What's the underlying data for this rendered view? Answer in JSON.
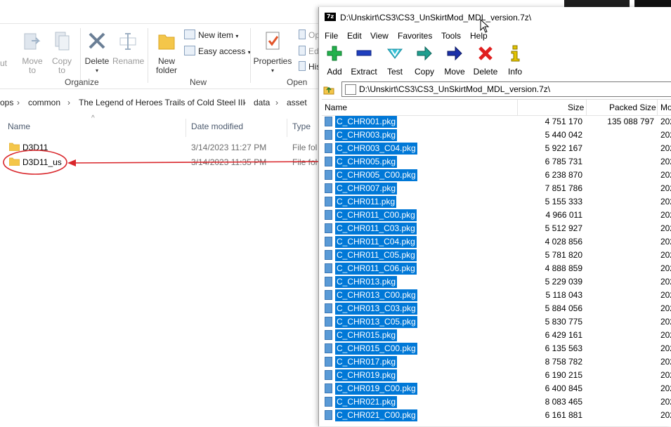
{
  "explorer": {
    "ribbon": {
      "move_to": "Move\nto",
      "copy_to": "Copy\nto",
      "delete": "Delete",
      "rename": "Rename",
      "new_folder": "New\nfolder",
      "new_item": "New item",
      "easy_access": "Easy access",
      "properties": "Properties",
      "open_partial": "Op",
      "edit_partial": "Ed",
      "history_partial": "His",
      "left_partial": "ut",
      "groups": {
        "organize": "Organize",
        "new": "New",
        "open": "Open"
      }
    },
    "breadcrumb": [
      "ops",
      "common",
      "The Legend of Heroes Trails of Cold Steel III",
      "data",
      "asset"
    ],
    "columns": {
      "name": "Name",
      "date": "Date modified",
      "type": "Type"
    },
    "files": [
      {
        "name": "D3D11",
        "date": "3/14/2023 11:27 PM",
        "type": "File fol"
      },
      {
        "name": "D3D11_us",
        "date": "3/14/2023 11:35 PM",
        "type": "File fol"
      }
    ]
  },
  "sevenzip": {
    "app_icon": "7z",
    "title": "D:\\Unskirt\\CS3\\CS3_UnSkirtMod_MDL_version.7z\\",
    "menu": [
      "File",
      "Edit",
      "View",
      "Favorites",
      "Tools",
      "Help"
    ],
    "toolbar": [
      {
        "label": "Add",
        "icon": "plus-icon",
        "color": "#22b14c"
      },
      {
        "label": "Extract",
        "icon": "minus-icon",
        "color": "#1f3fbf"
      },
      {
        "label": "Test",
        "icon": "check-icon",
        "color": "#36c3d8"
      },
      {
        "label": "Copy",
        "icon": "copy-arrow-icon",
        "color": "#1f9e8f"
      },
      {
        "label": "Move",
        "icon": "move-arrow-icon",
        "color": "#1a2fa8"
      },
      {
        "label": "Delete",
        "icon": "x-icon",
        "color": "#e02020"
      },
      {
        "label": "Info",
        "icon": "info-icon",
        "color": "#e3c400"
      }
    ],
    "path": "D:\\Unskirt\\CS3\\CS3_UnSkirtMod_MDL_version.7z\\",
    "columns": {
      "name": "Name",
      "size": "Size",
      "packed": "Packed Size",
      "modified": "Mo"
    },
    "files": [
      {
        "name": "C_CHR001.pkg",
        "size": "4 751 170",
        "packed": "135 088 797",
        "mod": "202"
      },
      {
        "name": "C_CHR003.pkg",
        "size": "5 440 042",
        "packed": "",
        "mod": "202"
      },
      {
        "name": "C_CHR003_C04.pkg",
        "size": "5 922 167",
        "packed": "",
        "mod": "202"
      },
      {
        "name": "C_CHR005.pkg",
        "size": "6 785 731",
        "packed": "",
        "mod": "202"
      },
      {
        "name": "C_CHR005_C00.pkg",
        "size": "6 238 870",
        "packed": "",
        "mod": "202"
      },
      {
        "name": "C_CHR007.pkg",
        "size": "7 851 786",
        "packed": "",
        "mod": "202"
      },
      {
        "name": "C_CHR011.pkg",
        "size": "5 155 333",
        "packed": "",
        "mod": "202"
      },
      {
        "name": "C_CHR011_C00.pkg",
        "size": "4 966 011",
        "packed": "",
        "mod": "202"
      },
      {
        "name": "C_CHR011_C03.pkg",
        "size": "5 512 927",
        "packed": "",
        "mod": "202"
      },
      {
        "name": "C_CHR011_C04.pkg",
        "size": "4 028 856",
        "packed": "",
        "mod": "202"
      },
      {
        "name": "C_CHR011_C05.pkg",
        "size": "5 781 820",
        "packed": "",
        "mod": "202"
      },
      {
        "name": "C_CHR011_C06.pkg",
        "size": "4 888 859",
        "packed": "",
        "mod": "202"
      },
      {
        "name": "C_CHR013.pkg",
        "size": "5 229 039",
        "packed": "",
        "mod": "202"
      },
      {
        "name": "C_CHR013_C00.pkg",
        "size": "5 118 043",
        "packed": "",
        "mod": "202"
      },
      {
        "name": "C_CHR013_C03.pkg",
        "size": "5 884 056",
        "packed": "",
        "mod": "202"
      },
      {
        "name": "C_CHR013_C05.pkg",
        "size": "5 830 775",
        "packed": "",
        "mod": "202"
      },
      {
        "name": "C_CHR015.pkg",
        "size": "6 429 161",
        "packed": "",
        "mod": "202"
      },
      {
        "name": "C_CHR015_C00.pkg",
        "size": "6 135 563",
        "packed": "",
        "mod": "202"
      },
      {
        "name": "C_CHR017.pkg",
        "size": "8 758 782",
        "packed": "",
        "mod": "202"
      },
      {
        "name": "C_CHR019.pkg",
        "size": "6 190 215",
        "packed": "",
        "mod": "202"
      },
      {
        "name": "C_CHR019_C00.pkg",
        "size": "6 400 845",
        "packed": "",
        "mod": "202"
      },
      {
        "name": "C_CHR021.pkg",
        "size": "8 083 465",
        "packed": "",
        "mod": "202"
      },
      {
        "name": "C_CHR021_C00.pkg",
        "size": "6 161 881",
        "packed": "",
        "mod": "202"
      }
    ],
    "selection_color": "#0078d7"
  },
  "annotation_color": "#d9262b"
}
